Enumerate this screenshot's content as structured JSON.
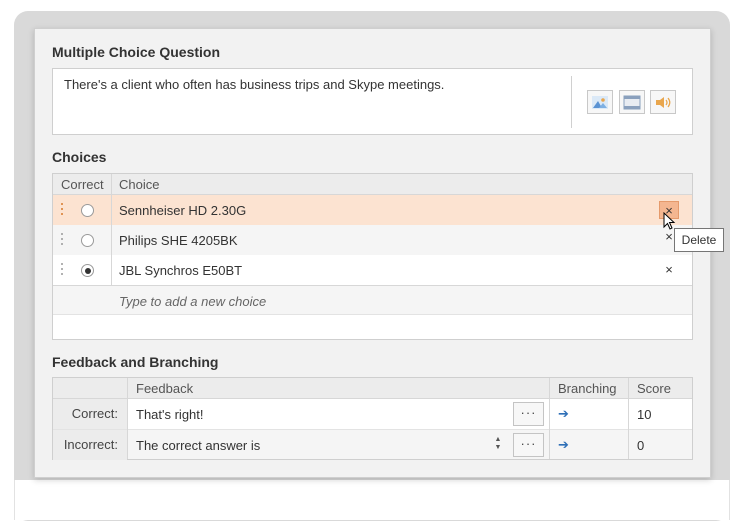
{
  "question": {
    "title": "Multiple Choice Question",
    "text": "There's a client who often has business trips and Skype meetings.",
    "media_icons": [
      "image-icon",
      "video-icon",
      "audio-icon"
    ]
  },
  "choices": {
    "title": "Choices",
    "col_correct": "Correct",
    "col_choice": "Choice",
    "items": [
      {
        "label": "Sennheiser HD 2.30G",
        "correct": false,
        "selected": true
      },
      {
        "label": "Philips SHE 4205BK",
        "correct": false,
        "selected": false
      },
      {
        "label": "JBL Synchros E50BT",
        "correct": true,
        "selected": false
      }
    ],
    "add_placeholder": "Type to add a new choice",
    "delete_glyph": "×",
    "tooltip": "Delete"
  },
  "feedback": {
    "title": "Feedback and Branching",
    "col_feedback": "Feedback",
    "col_branching": "Branching",
    "col_score": "Score",
    "rows": [
      {
        "label": "Correct:",
        "text": "That's right!",
        "score": "10"
      },
      {
        "label": "Incorrect:",
        "text": "The correct answer is",
        "score": "0"
      }
    ],
    "more_glyph": "···",
    "arrow_glyph": "➔"
  },
  "colors": {
    "accent": "#d77a2c",
    "selected_row": "#fce3d1",
    "delete_hover": "#f4b690",
    "branch_arrow": "#2e6fb7"
  }
}
